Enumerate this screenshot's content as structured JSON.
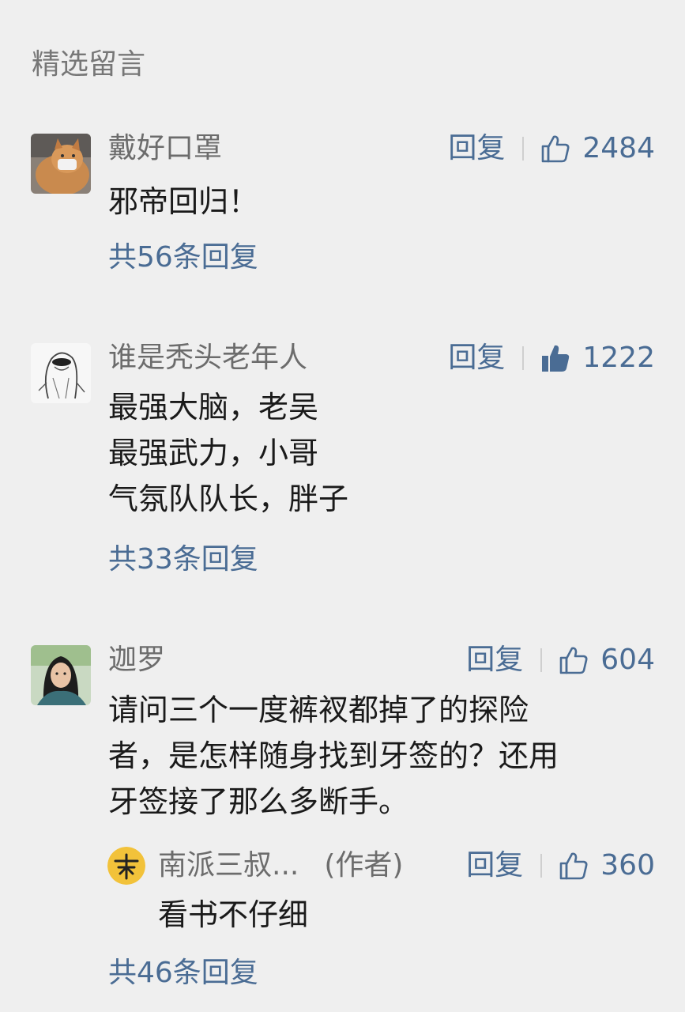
{
  "section": {
    "title": "精选留言"
  },
  "comments": [
    {
      "nickname": "戴好口罩",
      "reply_label": "回复",
      "likes": "2484",
      "liked": false,
      "lines": [
        "邪帝回归！"
      ],
      "replies_link": "共56条回复"
    },
    {
      "nickname": "谁是秃头老年人",
      "reply_label": "回复",
      "likes": "1222",
      "liked": true,
      "lines": [
        "最强大脑，老吴",
        "最强武力，小哥",
        "气氛队队长，胖子"
      ],
      "replies_link": "共33条回复"
    },
    {
      "nickname": "迦罗",
      "reply_label": "回复",
      "likes": "604",
      "liked": false,
      "lines": [
        "请问三个一度裤衩都掉了的探险",
        "者，是怎样随身找到牙签的？还用",
        "牙签接了那么多断手。"
      ],
      "author_reply": {
        "name": "南派三叔...",
        "tag": "(作者)",
        "reply_label": "回复",
        "likes": "360",
        "liked": false,
        "text": "看书不仔细"
      },
      "replies_link": "共46条回复"
    }
  ],
  "colors": {
    "accent": "#4a6c94",
    "nickname": "#6c6c6c",
    "background": "#efefef"
  },
  "icons": {
    "like": "thumbs-up-icon",
    "liked": "thumbs-up-filled-icon"
  }
}
